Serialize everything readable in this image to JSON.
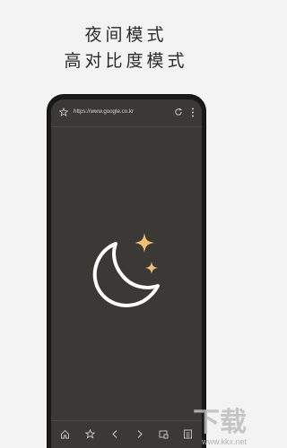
{
  "heading": {
    "line1": "夜间模式",
    "line2": "高对比度模式"
  },
  "browser": {
    "url": "https://www.google.co.kr",
    "toolbar_icons": [
      "star-icon",
      "reload-icon",
      "more-icon"
    ],
    "nav_icons": [
      "home-icon",
      "bookmark-star-icon",
      "back-icon",
      "forward-icon",
      "tabs-icon",
      "menu-icon"
    ]
  },
  "colors": {
    "screen_bg": "#3a3936",
    "moon_stroke": "#ffffff",
    "star_fill": "#f0c070"
  },
  "watermark": {
    "text": "下载",
    "site": "www.kkx.net"
  }
}
